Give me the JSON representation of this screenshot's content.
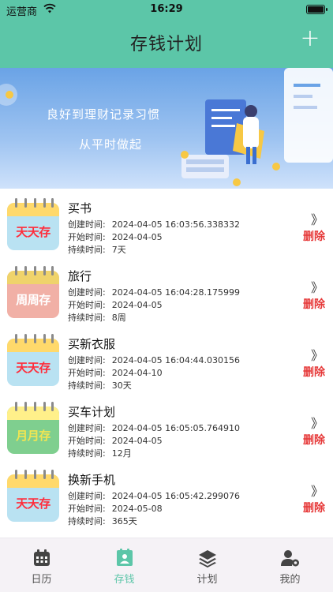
{
  "status_bar": {
    "carrier": "运营商",
    "time": "16:29"
  },
  "header": {
    "title": "存钱计划",
    "add_label": "+"
  },
  "banner": {
    "line1": "良好到理财记录习惯",
    "line2": "从平时做起"
  },
  "plans": [
    {
      "name": "买书",
      "type_label": "天天存",
      "type": "day",
      "created_label": "创建时间:",
      "created": "2024-04-05 16:03:56.338332",
      "start_label": "开始时间:",
      "start": "2024-04-05",
      "duration_label": "持续时间:",
      "duration": "7天",
      "arrow": "》",
      "delete_label": "删除"
    },
    {
      "name": "旅行",
      "type_label": "周周存",
      "type": "week",
      "created_label": "创建时间:",
      "created": "2024-04-05 16:04:28.175999",
      "start_label": "开始时间:",
      "start": "2024-04-05",
      "duration_label": "持续时间:",
      "duration": "8周",
      "arrow": "》",
      "delete_label": "删除"
    },
    {
      "name": "买新衣服",
      "type_label": "天天存",
      "type": "day",
      "created_label": "创建时间:",
      "created": "2024-04-05 16:04:44.030156",
      "start_label": "开始时间:",
      "start": "2024-04-10",
      "duration_label": "持续时间:",
      "duration": "30天",
      "arrow": "》",
      "delete_label": "删除"
    },
    {
      "name": "买车计划",
      "type_label": "月月存",
      "type": "month",
      "created_label": "创建时间:",
      "created": "2024-04-05 16:05:05.764910",
      "start_label": "开始时间:",
      "start": "2024-04-05",
      "duration_label": "持续时间:",
      "duration": "12月",
      "arrow": "》",
      "delete_label": "删除"
    },
    {
      "name": "换新手机",
      "type_label": "天天存",
      "type": "day",
      "created_label": "创建时间:",
      "created": "2024-04-05 16:05:42.299076",
      "start_label": "开始时间:",
      "start": "2024-05-08",
      "duration_label": "持续时间:",
      "duration": "365天",
      "arrow": "》",
      "delete_label": "删除"
    }
  ],
  "tabs": [
    {
      "label": "日历",
      "icon": "calendar-icon",
      "active": false
    },
    {
      "label": "存钱",
      "icon": "savings-icon",
      "active": true
    },
    {
      "label": "计划",
      "icon": "layers-icon",
      "active": false
    },
    {
      "label": "我的",
      "icon": "user-settings-icon",
      "active": false
    }
  ],
  "colors": {
    "accent": "#5cc6a8",
    "delete": "#e63838",
    "background": "#f6f4f8"
  }
}
